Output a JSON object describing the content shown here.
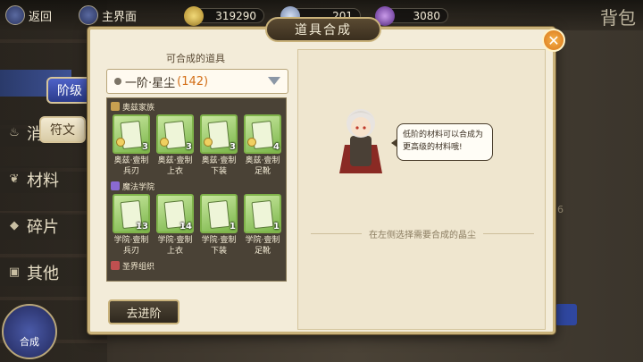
{
  "topbar": {
    "back_label": "返回",
    "main_label": "主界面",
    "resources": [
      {
        "name": "coin",
        "value": "319290",
        "color": "#d9b64a"
      },
      {
        "name": "crystal",
        "value": "201",
        "color": "#9ab0d8"
      },
      {
        "name": "gem",
        "value": "3080",
        "color": "#9a63c8"
      }
    ],
    "bag_title": "背包"
  },
  "categories": [
    {
      "label": "消",
      "icon": "potion-icon"
    },
    {
      "label": "材料",
      "icon": "leaf-icon"
    },
    {
      "label": "碎片",
      "icon": "shard-icon"
    },
    {
      "label": "其他",
      "icon": "bag-icon"
    }
  ],
  "tabs": {
    "level": "阶级",
    "rune": "符文"
  },
  "synth_corner_label": "合成",
  "dialog": {
    "title": "道具合成",
    "left_title": "可合成的道具",
    "select": {
      "label": "一阶·星尘",
      "count": "(142)"
    },
    "groups": [
      {
        "name": "奥兹家族",
        "icon_color": "#c8a050",
        "items": [
          {
            "label": "奥兹·壹制兵刃",
            "count": "3"
          },
          {
            "label": "奥兹·壹制上衣",
            "count": "3"
          },
          {
            "label": "奥兹·壹制下装",
            "count": "3"
          },
          {
            "label": "奥兹·壹制足靴",
            "count": "4"
          }
        ]
      },
      {
        "name": "魔法学院",
        "icon_color": "#8a6ad0",
        "items": [
          {
            "label": "学院·壹制兵刃",
            "count": "13"
          },
          {
            "label": "学院·壹制上衣",
            "count": "14"
          },
          {
            "label": "学院·壹制下装",
            "count": "1"
          },
          {
            "label": "学院·壹制足靴",
            "count": "1"
          }
        ]
      },
      {
        "name": "圣界组织",
        "icon_color": "#c05050",
        "items": []
      }
    ],
    "advance_button": "去进阶",
    "bubble_text": "低阶的材料可以合成为更高级的材料哦!",
    "hint": "在左侧选择需要合成的晶尘"
  },
  "bg_numeral": "6"
}
